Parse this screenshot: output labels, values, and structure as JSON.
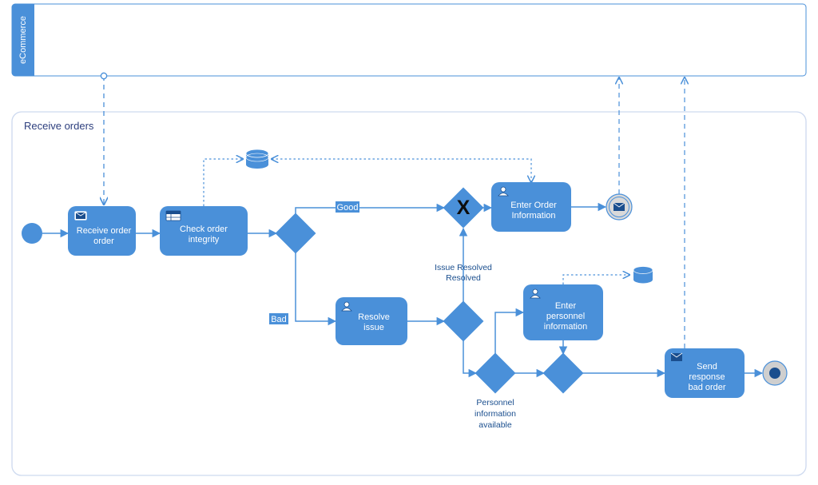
{
  "pool": {
    "label": "eCommerce"
  },
  "group": {
    "label": "Receive orders"
  },
  "tasks": {
    "receive_order": "Receive order",
    "check_integrity": "Check order integrity",
    "enter_order": "Enter Order Information",
    "resolve_issue": "Resolve issue",
    "enter_personnel": "Enter personnel information",
    "send_bad": "Send response bad order"
  },
  "gateways": {
    "integrity_branch": "",
    "exclusive_merge": "",
    "resolve_branch": "",
    "personnel_branch": "",
    "merge_after_personnel": ""
  },
  "labels": {
    "good": "Good",
    "bad": "Bad",
    "issue_resolved": "Issue Resolved",
    "personnel_available_l1": "Personnel",
    "personnel_available_l2": "information",
    "personnel_available_l3": "available"
  },
  "events": {
    "start": "start-event",
    "msg_throw": "message-throw-event",
    "end": "end-event"
  }
}
